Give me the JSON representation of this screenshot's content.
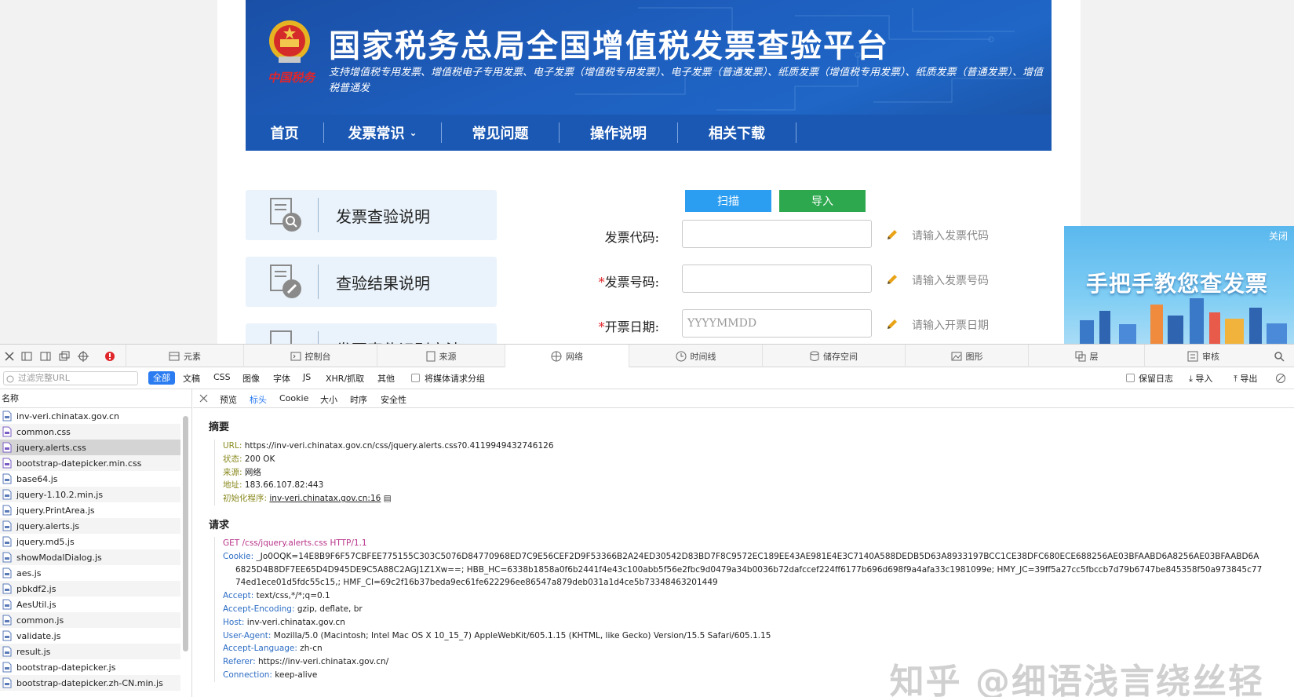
{
  "site": {
    "title": "国家税务总局全国增值税发票查验平台",
    "subtitle": "支持增值税专用发票、增值税电子专用发票、电子发票（增值税专用发票）、电子发票（普通发票）、纸质发票（增值税专用发票）、纸质发票（普通发票）、增值税普通发",
    "emblem_text": "中国税务"
  },
  "nav": {
    "items": [
      {
        "label": "首页"
      },
      {
        "label": "发票常识",
        "caret": "⌄"
      },
      {
        "label": "常见问题"
      },
      {
        "label": "操作说明"
      },
      {
        "label": "相关下载"
      }
    ]
  },
  "side_cards": [
    {
      "label": "发票查验说明",
      "icon": "search-doc-icon"
    },
    {
      "label": "查验结果说明",
      "icon": "edit-doc-icon"
    },
    {
      "label": "发票真伪识别方法",
      "icon": "doc-icon"
    }
  ],
  "form": {
    "scan_label": "扫描",
    "import_label": "导入",
    "fields": [
      {
        "label": "发票代码:",
        "required": false,
        "placeholder": "",
        "hint": "请输入发票代码"
      },
      {
        "label": "发票号码:",
        "required": true,
        "placeholder": "",
        "hint": "请输入发票号码"
      },
      {
        "label": "开票日期:",
        "required": true,
        "placeholder": "YYYYMMDD",
        "hint": "请输入开票日期"
      }
    ],
    "required_mark": "*"
  },
  "ad": {
    "close_label": "关闭",
    "title": "手把手教您查发票"
  },
  "devtools": {
    "tabs": [
      {
        "label": "元素",
        "icon": "elements-icon"
      },
      {
        "label": "控制台",
        "icon": "console-icon"
      },
      {
        "label": "来源",
        "icon": "sources-icon"
      },
      {
        "label": "网络",
        "icon": "network-icon",
        "active": true
      },
      {
        "label": "时间线",
        "icon": "timeline-icon"
      },
      {
        "label": "储存空间",
        "icon": "storage-icon"
      },
      {
        "label": "图形",
        "icon": "graphics-icon"
      },
      {
        "label": "层",
        "icon": "layers-icon"
      },
      {
        "label": "审核",
        "icon": "audit-icon"
      }
    ],
    "filter_placeholder": "过滤完整URL",
    "filter_types": [
      "全部",
      "文稿",
      "CSS",
      "图像",
      "字体",
      "JS",
      "XHR/抓取",
      "其他"
    ],
    "group_media_label": "将媒体请求分组",
    "preserve_log_label": "保留日志",
    "import_label": "导入",
    "export_label": "导出",
    "list_header": "名称",
    "files": [
      "inv-veri.chinatax.gov.cn",
      "common.css",
      "jquery.alerts.css",
      "bootstrap-datepicker.min.css",
      "base64.js",
      "jquery-1.10.2.min.js",
      "jquery.PrintArea.js",
      "jquery.alerts.js",
      "jquery.md5.js",
      "showModalDialog.js",
      "aes.js",
      "pbkdf2.js",
      "AesUtil.js",
      "common.js",
      "validate.js",
      "result.js",
      "bootstrap-datepicker.js",
      "bootstrap-datepicker.zh-CN.min.js"
    ],
    "selected_file": "jquery.alerts.css",
    "detail_tabs": [
      "预览",
      "标头",
      "Cookie",
      "大小",
      "时序",
      "安全性"
    ],
    "active_detail_tab": "标头",
    "summary_title": "摘要",
    "summary": [
      {
        "k": "URL:",
        "v": "https://inv-veri.chinatax.gov.cn/css/jquery.alerts.css?0.4119949432746126"
      },
      {
        "k": "状态:",
        "v": "200 OK"
      },
      {
        "k": "来源:",
        "v": "网络"
      },
      {
        "k": "地址:",
        "v": "183.66.107.82:443"
      },
      {
        "k": "初始化程序:",
        "v": "inv-veri.chinatax.gov.cn:16"
      }
    ],
    "request_title": "请求",
    "request_line": "GET /css/jquery.alerts.css HTTP/1.1",
    "request_headers": [
      {
        "k": "Cookie:",
        "v": "_Jo0OQK=14E8B9F6F57CBFEE775155C303C5076D84770968ED7C9E56CEF2D9F53366B2A24ED30542D83BD7F8C9572EC189EE43AE981E4E3C7140A588DEDB5D63A8933197BCC1CE38DFC680ECE688256AE03BFAABD6A8256AE03BFAABD6A6825D4B8DF7EE65D4D945DE9C5A88C2AGJ1Z1Xw==; HBB_HC=6338b1858a0f6b2441f4e43c100abb5f56e2fbc9d0479a34b0036b72dafccef224ff6177b696d698f9a4afa33c1981099e; HMY_JC=39ff5a27cc5fbccb7d79b6747be845358f50a973845c7774ed1ece01d5fdc55c15,; HMF_CI=69c2f16b37beda9ec61fe622296ee86547a879deb031a1d4ce5b73348463201449"
      },
      {
        "k": "Accept:",
        "v": "text/css,*/*;q=0.1"
      },
      {
        "k": "Accept-Encoding:",
        "v": "gzip, deflate, br"
      },
      {
        "k": "Host:",
        "v": "inv-veri.chinatax.gov.cn"
      },
      {
        "k": "User-Agent:",
        "v": "Mozilla/5.0 (Macintosh; Intel Mac OS X 10_15_7) AppleWebKit/605.1.15 (KHTML, like Gecko) Version/15.5 Safari/605.1.15"
      },
      {
        "k": "Accept-Language:",
        "v": "zh-cn"
      },
      {
        "k": "Referer:",
        "v": "https://inv-veri.chinatax.gov.cn/"
      },
      {
        "k": "Connection:",
        "v": "keep-alive"
      }
    ]
  },
  "watermark": "知乎 @细语浅言绕丝轻",
  "colors": {
    "banner_blue": "#1e5fbf",
    "scan_blue": "#2c9ef2",
    "import_green": "#2ea84e",
    "required_red": "#e0262b",
    "devtools_accent": "#2b7cf1"
  }
}
